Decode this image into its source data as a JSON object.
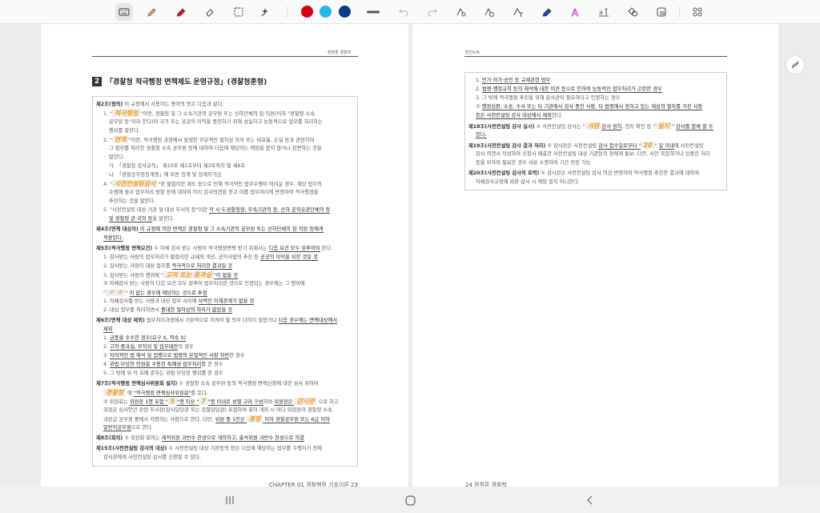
{
  "toolbar": {
    "tools": [
      "keyboard-icon",
      "pen-icon",
      "highlighter-icon",
      "eraser-icon",
      "lasso-select-icon",
      "magic-icon"
    ],
    "colors": [
      "#d90012",
      "#27b5ea",
      "#0b3a82"
    ],
    "right_tools": [
      "shape-select-icon",
      "shape-time-icon",
      "shape-text-icon",
      "ink-pen-icon",
      "text-style-icon",
      "text-size-icon",
      "shapes-icon",
      "lock-icon",
      "more-apps-icon"
    ]
  },
  "left_page": {
    "header": "장정훈 경찰학",
    "title_number": "2",
    "title": "「경찰청 적극행정 면책제도 운영규정」(경찰청훈령)",
    "footer": "CHAPTER 01 경찰행정 기초이론  23",
    "lines": [
      {
        "c": "",
        "s": [
          [
            "b",
            "제2조(정의)"
          ],
          [
            "n",
            " 이 규정에서 사용하는 용어의 뜻은 다음과 같다."
          ]
        ]
      },
      {
        "c": "i1",
        "s": [
          [
            "n",
            "1. \""
          ],
          [
            "h",
            "적극행정"
          ],
          [
            "n",
            "\"이란, 경찰청 및 그 소속기관의 공무원 또는 산하단체의 임·직원(이하 \"경찰청 소속"
          ]
        ]
      },
      {
        "c": "i2",
        "s": [
          [
            "n",
            "공무원 등\"이라 한다)이 국가 또는 공공의 이익을 증진하기 위해 성실하고 능동적으로 업무를 처리하는"
          ]
        ]
      },
      {
        "c": "i2",
        "s": [
          [
            "n",
            "행위를 말한다."
          ]
        ]
      },
      {
        "c": "i1",
        "s": [
          [
            "n",
            "2. \""
          ],
          [
            "h",
            "면책"
          ],
          [
            "n",
            "\"이란, 적극행정 과정에서 발생한 부분적인 절차상 하자 또는 비효율, 손실 등과 관련하여"
          ]
        ]
      },
      {
        "c": "i2",
        "s": [
          [
            "n",
            "그 업무를 처리한 경찰청 소속 공무원 등에 대하여 다음에 해당하는 책임을 묻지 않거나 감면하는 것을"
          ]
        ]
      },
      {
        "c": "i2",
        "s": [
          [
            "n",
            "말한다."
          ]
        ]
      },
      {
        "c": "i2",
        "s": [
          [
            "n",
            "가. 「경찰청 감사규칙」 제10조 제1호부터 제3호까지 및 제6호"
          ]
        ]
      },
      {
        "c": "i2",
        "s": [
          [
            "n",
            "나. 「경찰공무원징계령」에 따른 징계 및 징계부가금"
          ]
        ]
      },
      {
        "c": "i1",
        "s": [
          [
            "n",
            "4. \""
          ],
          [
            "h",
            "사전컨설팅감사"
          ],
          [
            "n",
            "\"란 불합리한 제도 등으로 인해 적극적인 업무수행이 어려운 경우, 해당 업무의"
          ]
        ]
      },
      {
        "c": "i2",
        "s": [
          [
            "n",
            "수행에 앞서 업무처리 방향 등에 대하여 미리 감사의견을 듣고 이를 업무처리에 반영하여 적극행정을"
          ]
        ]
      },
      {
        "c": "i2",
        "s": [
          [
            "n",
            "추진하는 것을 말한다."
          ]
        ]
      },
      {
        "c": "i1",
        "s": [
          [
            "n",
            "5. \"사전컨설팅 대상 기관 및 대상 부서의 장\"이란 "
          ],
          [
            "u",
            "각 시·도경찰청장, 부속기관의 장, 산하 공직유관단체의 장"
          ]
        ]
      },
      {
        "c": "i2",
        "s": [
          [
            "u",
            "및 경찰청 관·국의 장"
          ],
          [
            "n",
            "을 말한다."
          ]
        ]
      },
      {
        "c": "art",
        "s": [
          [
            "b",
            "제4조(면책 대상자)"
          ],
          [
            "u",
            " 이 규정에 의한 면책은 경찰청 및 그 소속기관의 공무원 또는 산하단체의 임·직원 등에게"
          ]
        ]
      },
      {
        "c": "i1",
        "s": [
          [
            "u",
            "적용된다."
          ]
        ]
      },
      {
        "c": "art",
        "s": [
          [
            "b",
            "제5조(적극행정 면책요건)"
          ],
          [
            "n",
            " ① 자체 감사 받는 사람이 적극행정면책 받기 위해서는 "
          ],
          [
            "u",
            "다음 요건 모두 갖추어야"
          ],
          [
            "n",
            " 한다."
          ]
        ]
      },
      {
        "c": "i1",
        "s": [
          [
            "n",
            "1. 감사받는 사람의 업무처리가 불합리한 규제의 개선, 공익사업의 추진 등 "
          ],
          [
            "u",
            "공공의 이익을 위한 것일 것"
          ]
        ]
      },
      {
        "c": "i1",
        "s": [
          [
            "n",
            "2. 감사받는 사람이 대상 업무를 "
          ],
          [
            "u",
            "적극적으로 처리한 결과일 것"
          ]
        ]
      },
      {
        "c": "i1",
        "s": [
          [
            "n",
            "3. 감사받는 사람의 행위에 \""
          ],
          [
            "h",
            "고의 또는 중과실"
          ],
          [
            "u",
            "\"이 없을 것"
          ]
        ]
      },
      {
        "c": "i1",
        "s": [
          [
            "n",
            "② 자체감사 받는 사람이 다음 요건 모두 갖추어 업무처리한 것으로 인정되는 경우에는 그 행위에"
          ]
        ]
      },
      {
        "c": "i1",
        "s": [
          [
            "n",
            "\""
          ],
          [
            "h",
            "〃 〃"
          ],
          [
            "n",
            "\" "
          ],
          [
            "u",
            "이 없는 경우에 해당하는 것으로 추정"
          ]
        ]
      },
      {
        "c": "i1",
        "s": [
          [
            "n",
            "1. 자체감사를 받는 사람과 대상 업무 사이에 "
          ],
          [
            "u",
            "사적인 이해관계가 없을 것"
          ]
        ]
      },
      {
        "c": "i1",
        "s": [
          [
            "n",
            "2. 대상 업무를 처리하면서 "
          ],
          [
            "u",
            "중대한 절차상의 하자가 없었을 것"
          ]
        ]
      },
      {
        "c": "art",
        "s": [
          [
            "b",
            "제6조(면책 대상 제외)"
          ],
          [
            "n",
            " 업무처리과정에서 기본적으로 지켜야 할 의무 다하지 않았거나 "
          ],
          [
            "u",
            "다음 경우에는 면책대상에서"
          ]
        ]
      },
      {
        "c": "i1",
        "s": [
          [
            "u",
            "제외"
          ]
        ]
      },
      {
        "c": "i1",
        "s": [
          [
            "n",
            "1. "
          ],
          [
            "u",
            "금품을 수수한 경우(요구 X, 약속 X)"
          ]
        ]
      },
      {
        "c": "i1",
        "s": [
          [
            "n",
            "2. "
          ],
          [
            "u",
            "고의·중과실, 부작위 및 업무태만"
          ],
          [
            "n",
            "의 경우"
          ]
        ]
      },
      {
        "c": "i1",
        "s": [
          [
            "n",
            "3. "
          ],
          [
            "u",
            "자의적인 법 해석 및 집행으로 법령의 본질적인 사항 위반"
          ],
          [
            "n",
            "한 경우"
          ]
        ]
      },
      {
        "c": "i1",
        "s": [
          [
            "n",
            "4. "
          ],
          [
            "u",
            "위법·부당한 민원을 수용한 특혜성 업무처리"
          ],
          [
            "n",
            "를 한 경우"
          ]
        ]
      },
      {
        "c": "i1",
        "s": [
          [
            "n",
            "5. 그 밖에 위 각 호에 준하는 위법·부당한 행위를 한 경우"
          ]
        ]
      },
      {
        "c": "art",
        "s": [
          [
            "b",
            "제7조(적극행정 면책심사위원회 설치)"
          ],
          [
            "n",
            " ① 경찰청 소속 공무원 등의 적극행정 면책신청에 대한 심사 위하여"
          ]
        ]
      },
      {
        "c": "i1",
        "s": [
          [
            "h",
            "경찰청"
          ],
          [
            "n",
            " 에 "
          ],
          [
            "u",
            "\"적극행정 면책심사위원회\""
          ],
          [
            "n",
            "를 둔다."
          ]
        ]
      },
      {
        "c": "i1",
        "s": [
          [
            "n",
            "② 위원회는 "
          ],
          [
            "u",
            "위원장 1명 포함 \""
          ],
          [
            "h",
            "5"
          ],
          [
            "u",
            "\"명 이상 \""
          ],
          [
            "h",
            "7"
          ],
          [
            "u",
            "\"명 이내로 성별 고려 구성"
          ],
          [
            "n",
            "하며 "
          ],
          [
            "u",
            "위원장은 "
          ],
          [
            "h",
            "감사관"
          ],
          [
            "n",
            " 으로 하고"
          ]
        ]
      },
      {
        "c": "i1",
        "s": [
          [
            "n",
            "위원은 심사안건 관련 부서장(감사담당관 또는 감찰담당관) 포함하여 회의 개최 시 마다 위원장이 경찰청 소속"
          ]
        ]
      },
      {
        "c": "i1",
        "s": [
          [
            "n",
            "과장급 공무원 중에서 지명하는 사람으로 한다. 다만, "
          ],
          [
            "u",
            "위원 중 1인은 "
          ],
          [
            "h",
            "경정"
          ],
          [
            "u",
            " 이하 경찰공무원 또는 6급 이하"
          ]
        ]
      },
      {
        "c": "i1",
        "s": [
          [
            "u",
            "일반직공무원"
          ],
          [
            "n",
            "으로 한다."
          ]
        ]
      },
      {
        "c": "art",
        "s": [
          [
            "b",
            "제8조(회의)"
          ],
          [
            "n",
            " ② 위원회 회의는 "
          ],
          [
            "u",
            "재적위원 과반수 찬성으로 개의하고, 출석위원 과반수 찬성으로 의결"
          ]
        ]
      },
      {
        "c": "art",
        "s": [
          [
            "b",
            "제15조(사전컨설팅 감사의 대상)"
          ],
          [
            "n",
            " ① 사전컨설팅 대상 기관등의 장은 다음에 해당하는 업무를 수행하기 전에"
          ]
        ]
      },
      {
        "c": "i1",
        "s": [
          [
            "n",
            "감사관에게 사전컨설팅 감사를 신청할 수 있다."
          ]
        ]
      }
    ]
  },
  "right_page": {
    "header": "빈칸노트",
    "footer": "24  장정훈 경찰학",
    "lines": [
      {
        "c": "i1",
        "s": [
          [
            "n",
            "1. "
          ],
          [
            "u",
            "인가·허가·승인 등 규제관련 업무"
          ]
        ]
      },
      {
        "c": "i1",
        "s": [
          [
            "n",
            "2. "
          ],
          [
            "u",
            "법령·행정규칙 등의 해석에 대한 이견 등으로 인하여 능동적인 업무처리가 곤란한 경우"
          ]
        ]
      },
      {
        "c": "i1",
        "s": [
          [
            "n",
            "3. 그 밖에 적극행정 추진을 위해 감사관이 필요하다고 인정하는 경우"
          ]
        ]
      },
      {
        "c": "i1",
        "s": [
          [
            "n",
            "② "
          ],
          [
            "u",
            "행정심판, 소송, 수사 또는 타 기관에서 감사 중인 사항, 타 법령에서 정하고 있는 재심의 절차를 거친 사항"
          ]
        ]
      },
      {
        "c": "i1",
        "s": [
          [
            "u",
            "등은 사전컨설팅 감사 대상에서 제외"
          ],
          [
            "n",
            "한다."
          ]
        ]
      },
      {
        "c": "art",
        "s": [
          [
            "b",
            "제18조(사전컨설팅 감사 실시)"
          ],
          [
            "n",
            " ① 사전컨설팅 감사는 \""
          ],
          [
            "h",
            "서면"
          ],
          [
            "u",
            "감사 원칙"
          ],
          [
            "n",
            ", 현지 확인 등 \""
          ],
          [
            "h",
            "실지"
          ],
          [
            "n",
            "\" "
          ],
          [
            "u",
            "감사를 함께 할 수"
          ]
        ]
      },
      {
        "c": "i1",
        "s": [
          [
            "u",
            "있다."
          ]
        ]
      },
      {
        "c": "art",
        "s": [
          [
            "b",
            "제19조(사전컨설팅 감사 결과 처리)"
          ],
          [
            "n",
            " ① 감사관은 사전컨설팅 "
          ],
          [
            "u",
            "감사 접수일로부터 \""
          ],
          [
            "h",
            "20"
          ],
          [
            "n",
            "\" "
          ],
          [
            "u",
            "일 이내"
          ],
          [
            "n",
            "에 사전컨설팅"
          ]
        ]
      },
      {
        "c": "i1",
        "s": [
          [
            "n",
            "감사 의견서 작성하여 신청서 제출한 사전컨설팅 대상 기관등의 장에게 통보. 다만, 사안 복잡하거나 신중한 처리"
          ]
        ]
      },
      {
        "c": "i1",
        "s": [
          [
            "n",
            "등을 위하여 필요한 경우 사유 소명하여 기간 연장 가능"
          ]
        ]
      },
      {
        "c": "art",
        "s": [
          [
            "b",
            "제20조(사전컨설팅 감사의 효력)"
          ],
          [
            "n",
            " ① 감사관은 사전컨설팅 감사 의견 반영하여 적극행정 추진한 결과에 대하여"
          ]
        ]
      },
      {
        "c": "i1",
        "s": [
          [
            "n",
            "자체감사규정에 따른 감사 시 책임 묻지 아니한다."
          ]
        ]
      }
    ]
  },
  "navbar": [
    "recent-apps-icon",
    "home-icon",
    "back-icon"
  ]
}
